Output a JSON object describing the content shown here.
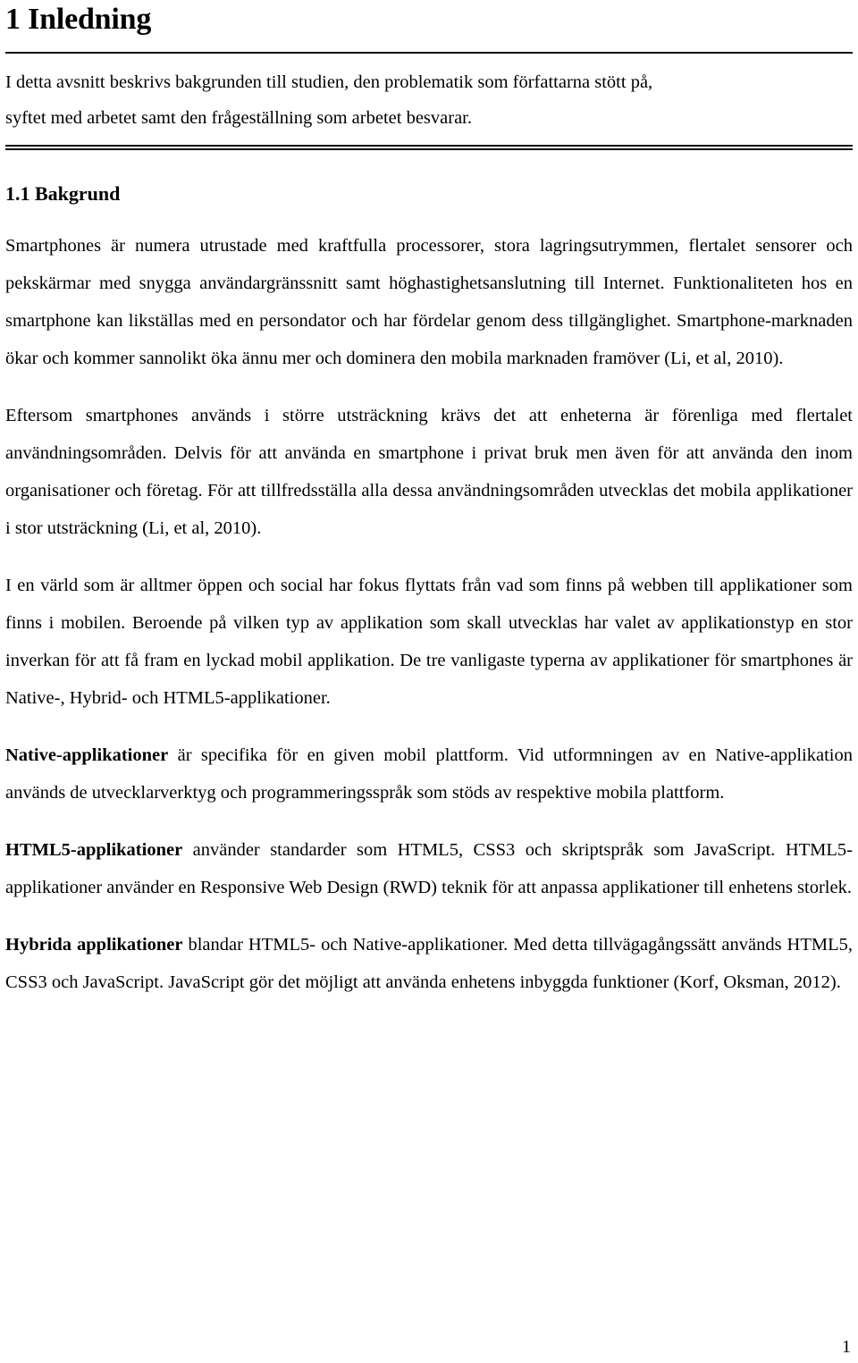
{
  "document": {
    "title": "1 Inledning",
    "page_number": "1"
  },
  "abstract": {
    "lines": [
      "I detta avsnitt beskrivs bakgrunden till studien, den problematik som författarna stött på,",
      "syftet med arbetet samt den frågeställning som arbetet besvarar."
    ]
  },
  "section": {
    "heading": "1.1 Bakgrund",
    "paragraphs": [
      {
        "lead": "",
        "text": "Smartphones är numera utrustade med kraftfulla processorer, stora lagringsutrymmen, flertalet sensorer och pekskärmar med snygga användargränssnitt samt höghastighetsanslutning till Internet. Funktionaliteten hos en smartphone kan likställas med en persondator och har fördelar genom dess tillgänglighet. Smartphone-marknaden ökar och kommer sannolikt öka ännu mer och dominera den mobila marknaden framöver (Li, et al, 2010)."
      },
      {
        "lead": "",
        "text": "Eftersom smartphones används i större utsträckning krävs det att enheterna är förenliga med flertalet användningsområden. Delvis för att använda en smartphone i privat bruk men även för att använda den inom organisationer och företag. För att tillfredsställa alla dessa användningsområden utvecklas det mobila applikationer i stor utsträckning (Li, et al, 2010)."
      },
      {
        "lead": "",
        "text": "I en värld som är alltmer öppen och social har fokus flyttats från vad som finns på webben till applikationer som finns i mobilen. Beroende på vilken typ av applikation som skall utvecklas har valet av applikationstyp en stor inverkan för att få fram en lyckad mobil applikation. De tre vanligaste typerna av applikationer för smartphones är Native-, Hybrid- och HTML5-applikationer."
      },
      {
        "lead": "Native-applikationer",
        "text": " är specifika för en given mobil plattform. Vid utformningen av en Native-applikation används de utvecklarverktyg och programmeringsspråk som stöds av respektive mobila plattform."
      },
      {
        "lead": "HTML5-applikationer",
        "text": " använder standarder som HTML5, CSS3 och skriptspråk som JavaScript. HTML5-applikationer använder en Responsive Web Design (RWD) teknik för att anpassa applikationer till enhetens storlek."
      },
      {
        "lead": "Hybrida applikationer",
        "text": " blandar HTML5- och Native-applikationer. Med detta tillvägagångssätt används HTML5, CSS3 och JavaScript. JavaScript gör det möjligt att använda enhetens inbyggda funktioner (Korf, Oksman, 2012)."
      }
    ]
  }
}
